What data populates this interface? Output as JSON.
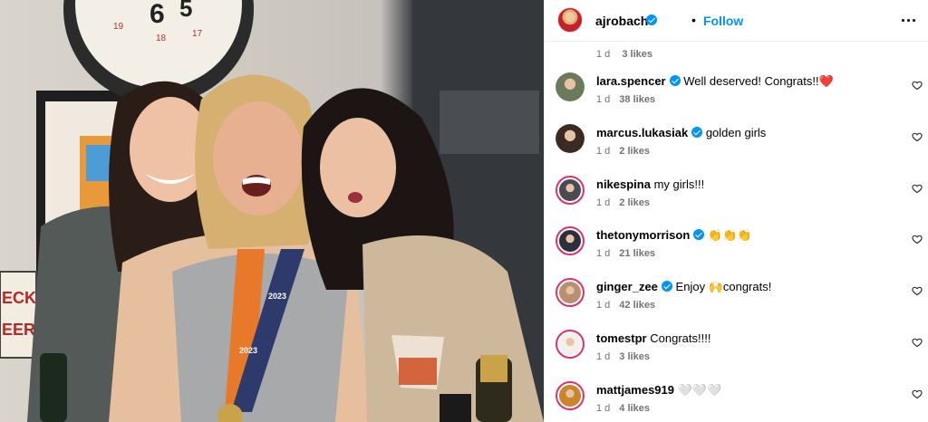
{
  "post": {
    "username": "ajrobach",
    "dot": "•",
    "follow_label": "Follow",
    "more_icon": "more-horizontal-icon"
  },
  "photo": {
    "clock_numbers": [
      "6",
      "5",
      "19",
      "18",
      "17"
    ],
    "medal_text": [
      "2023",
      "2023"
    ],
    "sign_text": [
      "ECK",
      "EER"
    ]
  },
  "comments": {
    "partial": {
      "time": "1 d",
      "likes": "3 likes"
    },
    "items": [
      {
        "username": "lara.spencer",
        "verified": true,
        "text": "Well deserved! Congrats!!❤️",
        "time": "1 d",
        "likes": "38 likes",
        "story_ring": false,
        "avatar_color": "#6b7a5a"
      },
      {
        "username": "marcus.lukasiak",
        "verified": true,
        "text": "golden girls",
        "time": "1 d",
        "likes": "2 likes",
        "story_ring": false,
        "avatar_color": "#3b2a24"
      },
      {
        "username": "nikespina",
        "verified": false,
        "text": "my girls!!!",
        "time": "1 d",
        "likes": "2 likes",
        "story_ring": true,
        "avatar_color": "#4a4a52"
      },
      {
        "username": "thetonymorrison",
        "verified": true,
        "text": "👏👏👏",
        "time": "1 d",
        "likes": "21 likes",
        "story_ring": true,
        "avatar_color": "#2d2f3a"
      },
      {
        "username": "ginger_zee",
        "verified": true,
        "text": "Enjoy 🙌congrats!",
        "time": "1 d",
        "likes": "42 likes",
        "story_ring": true,
        "avatar_color": "#b89070"
      },
      {
        "username": "tomestpr",
        "verified": false,
        "text": "Congrats!!!!",
        "time": "1 d",
        "likes": "3 likes",
        "story_ring": true,
        "avatar_color": "#f4efe9"
      },
      {
        "username": "mattjames919",
        "verified": false,
        "text": "🤍🤍🤍",
        "time": "1 d",
        "likes": "4 likes",
        "story_ring": true,
        "avatar_color": "#c9862a"
      }
    ]
  },
  "colors": {
    "accent": "#0095f6",
    "meta_text": "#737373",
    "story_ring": "#e1306c",
    "divider": "#efefef"
  }
}
